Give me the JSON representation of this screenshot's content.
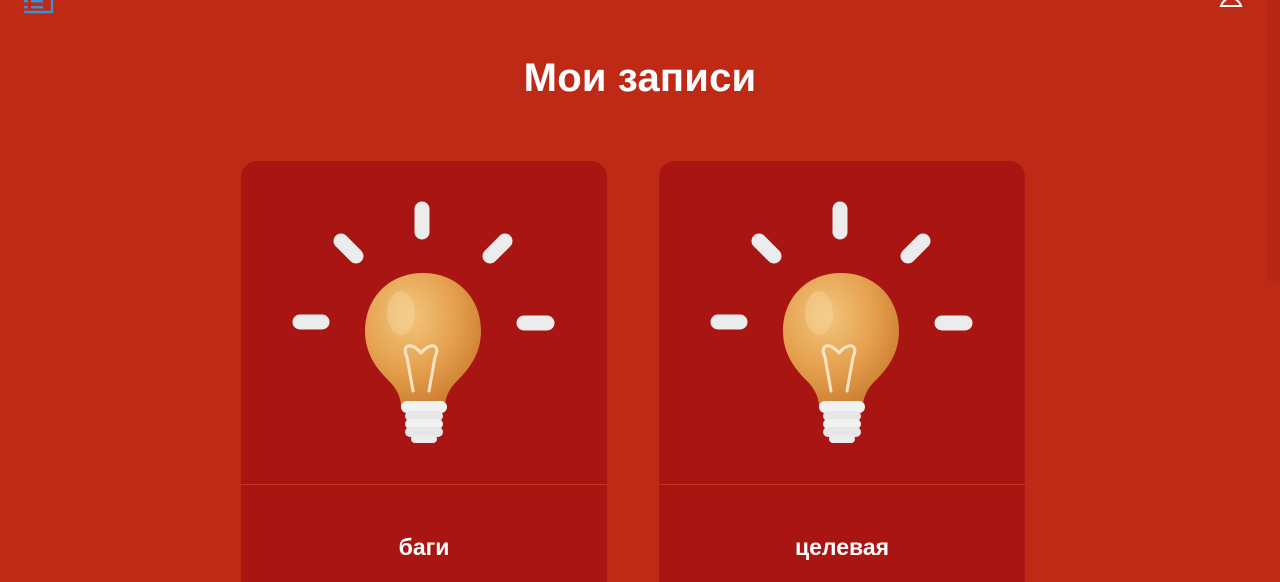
{
  "header": {
    "left_icon": "list-icon",
    "right_icon": "user-icon"
  },
  "page_title": "Мои записи",
  "cards": [
    {
      "title": "баги",
      "icon": "lightbulb-icon"
    },
    {
      "title": "целевая",
      "icon": "lightbulb-icon"
    }
  ],
  "colors": {
    "background": "#bf2a17",
    "card": "#a81512",
    "text": "#ffffff",
    "icon_accent": "#3b8fd4"
  }
}
